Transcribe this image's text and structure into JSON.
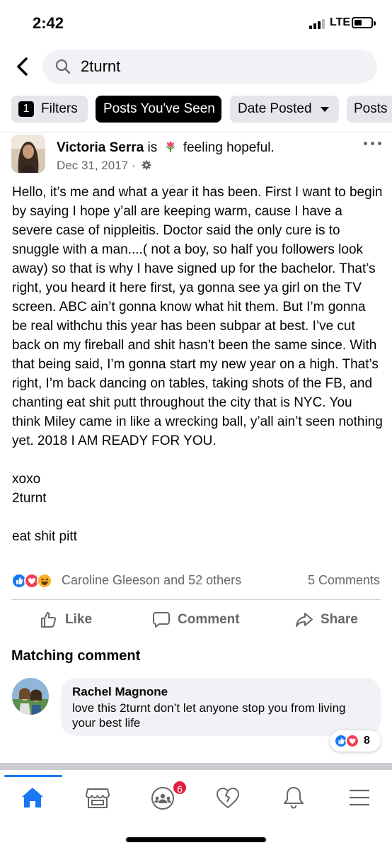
{
  "status_bar": {
    "time": "2:42",
    "network": "LTE"
  },
  "search": {
    "query": "2turnt"
  },
  "filters": {
    "count": "1",
    "filters_label": "Filters",
    "posts_seen_label": "Posts You've Seen",
    "date_posted_label": "Date Posted",
    "posts_label": "Posts"
  },
  "post": {
    "author": "Victoria Serra",
    "is_word": "is",
    "feeling": "feeling hopeful.",
    "feeling_icon": "tulip-emoji",
    "date": "Dec 31, 2017 ·",
    "privacy_icon": "gear-icon",
    "body": [
      "Hello, it’s me and what a year it has been. First I want to begin by saying I hope y’all are keeping warm, cause I have a severe case of nippleitis. Doctor said the only cure is to snuggle with a man....( not a boy, so half you followers look away) so that is why I have signed up for the bachelor. That’s right, you heard it here first, ya gonna see ya girl on the TV screen. ABC ain’t gonna know what hit them. But I’m gonna be real withchu this year has been subpar at best. I’ve cut back on my fireball and shit hasn’t been the same since. With that being said, I’m gonna start my new year on a high. That’s right, I’m back dancing on tables, taking shots of the FB, and chanting eat shit putt throughout the city that is NYC. You think Miley came in like a wrecking ball, y’all ain’t seen nothing yet. 2018 I AM READY FOR YOU.",
      "xoxo",
      "2turnt",
      "eat shit pitt"
    ],
    "reactions_text": "Caroline Gleeson and 52 others",
    "comments_count": "5 Comments",
    "reaction_types": [
      "like",
      "love",
      "haha"
    ]
  },
  "actions": {
    "like": "Like",
    "comment": "Comment",
    "share": "Share"
  },
  "matching": {
    "title": "Matching comment",
    "commenter": "Rachel Magnone",
    "text": "love this 2turnt don’t let anyone stop you from living your best life",
    "reaction_count": "8",
    "reaction_types": [
      "like",
      "love"
    ]
  },
  "bottom_nav": {
    "items": [
      "home-icon",
      "marketplace-icon",
      "groups-icon",
      "dating-icon",
      "notifications-icon",
      "menu-icon"
    ],
    "groups_badge": "6",
    "active": "home-icon"
  },
  "colors": {
    "brand_blue": "#1877f2",
    "badge_red": "#e41e3f",
    "secondary_text": "#65676b",
    "chip_bg": "#e4e6eb",
    "search_bg": "#f0f2f5"
  }
}
